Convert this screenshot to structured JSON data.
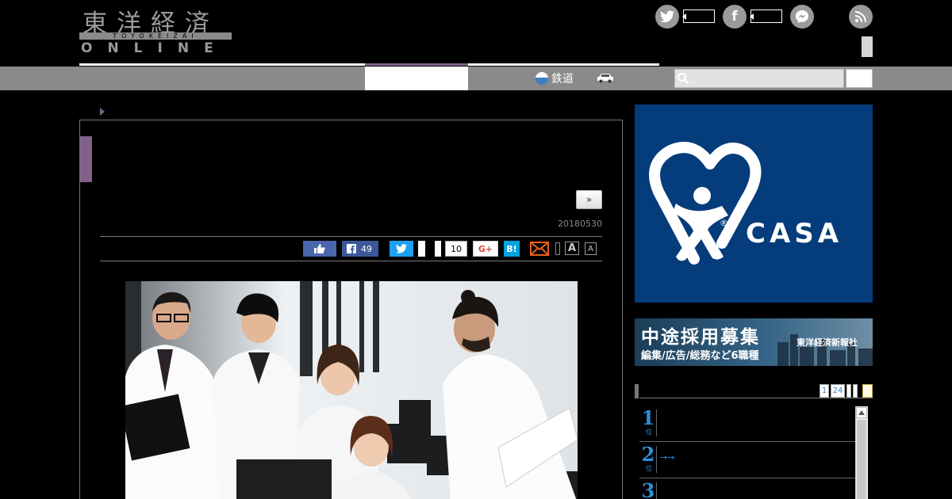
{
  "logo": {
    "kanji": "東洋経済",
    "romaji": "TOYOKEIZAI",
    "online": "ONLINE"
  },
  "nav": {
    "rail_label": "鉄道"
  },
  "search": {
    "placeholder": ""
  },
  "article": {
    "next_label": "»",
    "date": "20180530"
  },
  "share": {
    "facebook_count": "49",
    "pocket_count": "10",
    "gplus_label": "G+",
    "hatena_label": "B!",
    "font_large": "A",
    "font_small": "A"
  },
  "sidebar": {
    "ad_brand": "CASA",
    "ad_reg_mark": "®",
    "recruit_title": "中途採用募集",
    "recruit_sub": "編集/広告/総務など6職種",
    "recruit_company": "東洋経済新報社",
    "ranking_pages": [
      "1",
      "24"
    ],
    "ranking": [
      {
        "rank": "1",
        "unit": "位",
        "text": ""
      },
      {
        "rank": "2",
        "unit": "位",
        "text": "→→"
      },
      {
        "rank": "3",
        "unit": "位",
        "text": ""
      }
    ]
  },
  "colors": {
    "accent_purple": "#80618a",
    "nav_gray": "#8a8a8a",
    "casa_blue": "#053c7b",
    "rank_blue": "#2a8fd8"
  }
}
